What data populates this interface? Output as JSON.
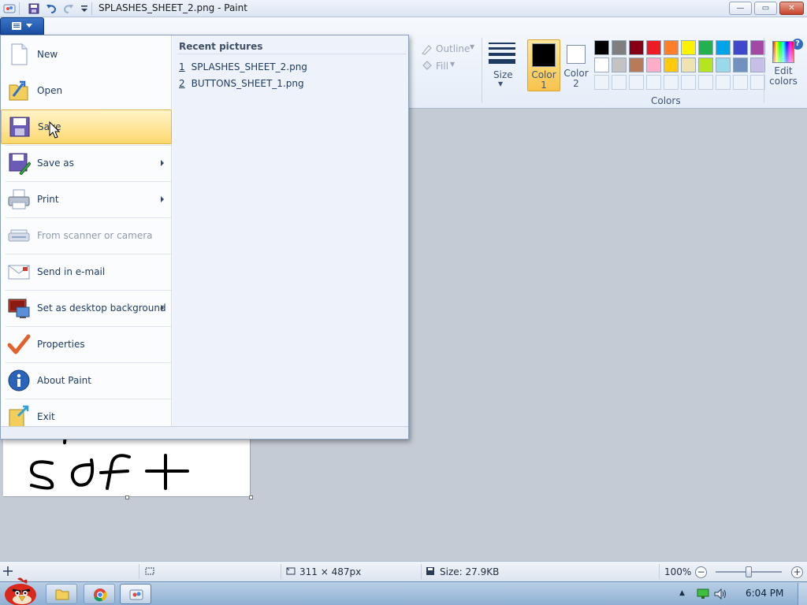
{
  "window": {
    "title": "SPLASHES_SHEET_2.png - Paint"
  },
  "title_buttons": {
    "minimize": "—",
    "maximize": "▭",
    "close": "✕"
  },
  "ribbon": {
    "outline_label": "Outline",
    "fill_label": "Fill",
    "size_label": "Size",
    "color1_label": "Color 1",
    "color2_label": "Color 2",
    "edit_colors_label": "Edit colors",
    "colors_group_label": "Colors",
    "help": "?"
  },
  "palette": {
    "row1": [
      "#000000",
      "#7f7f7f",
      "#880015",
      "#ed1c24",
      "#ff7f27",
      "#fff200",
      "#22b14c",
      "#00a2e8",
      "#3f48cc",
      "#a349a4"
    ],
    "row2": [
      "#ffffff",
      "#c3c3c3",
      "#b97a57",
      "#ffaec9",
      "#ffc90e",
      "#efe4b0",
      "#b5e61d",
      "#99d9ea",
      "#7092be",
      "#c8bfe7"
    ],
    "row3_empty_count": 10,
    "color1": "#000000",
    "color2": "#ffffff"
  },
  "file_menu": {
    "items": [
      {
        "label": "New",
        "icon": "new-file-icon",
        "submenu": false,
        "disabled": false
      },
      {
        "label": "Open",
        "icon": "open-folder-icon",
        "submenu": false,
        "disabled": false
      },
      {
        "label": "Save",
        "icon": "save-disk-icon",
        "submenu": false,
        "disabled": false,
        "hover": true
      },
      {
        "label": "Save as",
        "icon": "save-as-icon",
        "submenu": true,
        "disabled": false
      },
      {
        "label": "Print",
        "icon": "printer-icon",
        "submenu": true,
        "disabled": false
      },
      {
        "label": "From scanner or camera",
        "icon": "scanner-icon",
        "submenu": false,
        "disabled": true
      },
      {
        "label": "Send in e-mail",
        "icon": "email-icon",
        "submenu": false,
        "disabled": false
      },
      {
        "label": "Set as desktop background",
        "icon": "desktop-background-icon",
        "submenu": true,
        "disabled": false
      },
      {
        "label": "Properties",
        "icon": "checkmark-icon",
        "submenu": false,
        "disabled": false
      },
      {
        "label": "About Paint",
        "icon": "info-icon",
        "submenu": false,
        "disabled": false
      },
      {
        "label": "Exit",
        "icon": "exit-icon",
        "submenu": false,
        "disabled": false
      }
    ],
    "recent_header": "Recent pictures",
    "recent": [
      {
        "num": "1",
        "name": "SPLASHES_SHEET_2.png"
      },
      {
        "num": "2",
        "name": "BUTTONS_SHEET_1.png"
      }
    ]
  },
  "canvas_text": "s o f t",
  "status": {
    "dimensions": "311 × 487px",
    "size": "Size: 27.9KB",
    "zoom": "100%"
  },
  "taskbar": {
    "clock": "6:04 PM"
  }
}
